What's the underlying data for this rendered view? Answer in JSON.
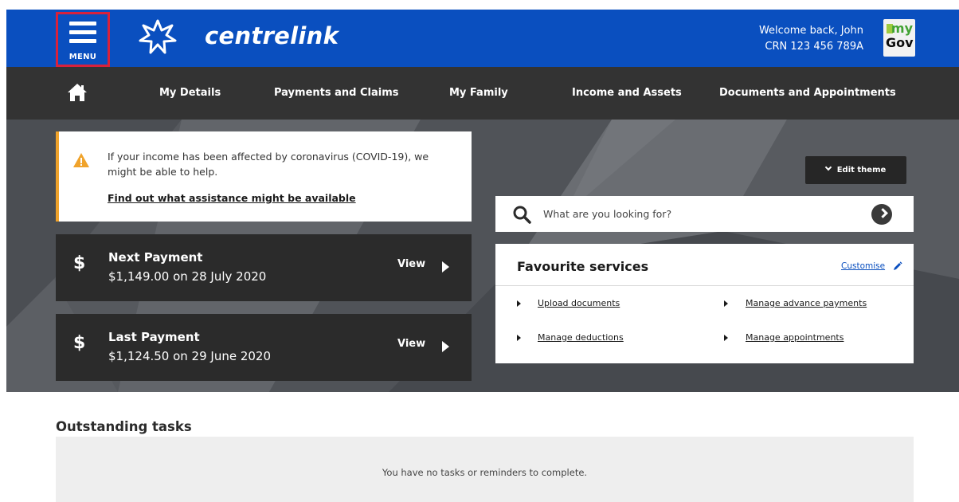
{
  "header": {
    "menu_label": "MENU",
    "brand": "centrelink",
    "welcome": "Welcome back, John",
    "crn": "CRN 123 456 789A",
    "mygov_my": "my",
    "mygov_gov": "Gov",
    "colors": {
      "header_blue": "#0a4fbf",
      "menu_highlight": "#d8213b"
    }
  },
  "nav": {
    "home_icon": "home-icon",
    "items": [
      {
        "label": "My Details"
      },
      {
        "label": "Payments and Claims"
      },
      {
        "label": "My Family"
      },
      {
        "label": "Income and Assets"
      },
      {
        "label": "Documents and Appointments"
      }
    ]
  },
  "alert": {
    "icon": "warning-icon",
    "text": "If your income has been affected by coronavirus (COVID-19), we might be able to help.",
    "link": "Find out what assistance might be available",
    "accent": "#f0a32b"
  },
  "payments": [
    {
      "symbol": "$",
      "title": "Next Payment",
      "detail": "$1,149.00 on 28 July 2020",
      "action": "View"
    },
    {
      "symbol": "$",
      "title": "Last Payment",
      "detail": "$1,124.50 on 29 June 2020",
      "action": "View"
    }
  ],
  "theme": {
    "edit_label": "Edit theme"
  },
  "search": {
    "placeholder": "What are you looking for?"
  },
  "favourites": {
    "title": "Favourite services",
    "customise": "Customise",
    "links": [
      {
        "label": "Upload documents"
      },
      {
        "label": "Manage advance payments"
      },
      {
        "label": "Manage deductions"
      },
      {
        "label": "Manage appointments"
      }
    ]
  },
  "tasks": {
    "heading": "Outstanding tasks",
    "empty": "You have no tasks or reminders to complete."
  }
}
